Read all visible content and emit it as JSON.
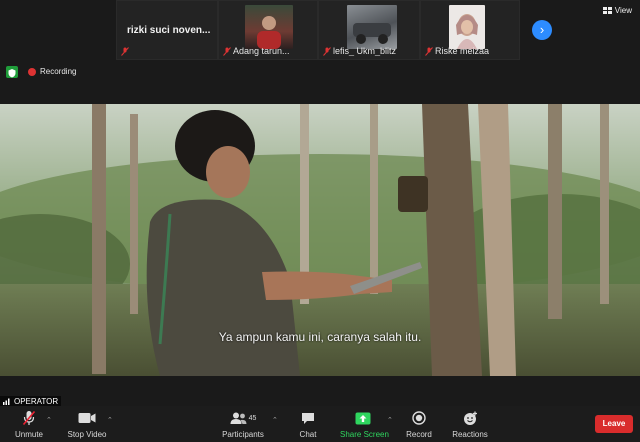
{
  "gallery": {
    "tiles": [
      {
        "name": "rizki suci noven..."
      },
      {
        "name": "Adang tarun..."
      },
      {
        "name": "lefis_ Ukm_blitz"
      },
      {
        "name": "Riske meizaa"
      }
    ],
    "view_label": "View"
  },
  "status": {
    "recording_label": "Recording"
  },
  "video": {
    "subtitle": "Ya ampun kamu ini, caranya salah itu.",
    "speaker_label": "OPERATOR"
  },
  "toolbar": {
    "unmute": "Unmute",
    "stop_video": "Stop Video",
    "participants": "Participants",
    "participants_count": "45",
    "chat": "Chat",
    "share_screen": "Share Screen",
    "record": "Record",
    "reactions": "Reactions",
    "leave": "Leave"
  },
  "colors": {
    "accent": "#2d8cff",
    "share_green": "#2fd65f",
    "leave_red": "#d92c2c",
    "recording_red": "#dd3333",
    "shield_green": "#1f9d3a"
  }
}
